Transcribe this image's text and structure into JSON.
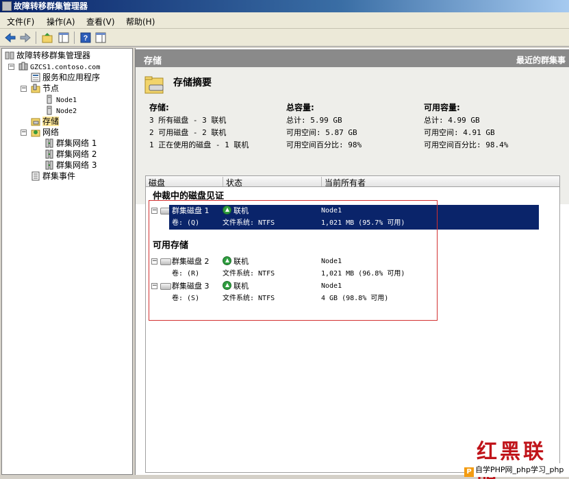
{
  "window": {
    "title": "故障转移群集管理器"
  },
  "menu": [
    "文件(F)",
    "操作(A)",
    "查看(V)",
    "帮助(H)"
  ],
  "tree": {
    "root": "故障转移群集管理器",
    "cluster": "GZCS1.contoso.com",
    "services": "服务和应用程序",
    "nodes": "节点",
    "node1": "Node1",
    "node2": "Node2",
    "storage": "存储",
    "networks": "网络",
    "net1": "群集网络 1",
    "net2": "群集网络 2",
    "net3": "群集网络 3",
    "events": "群集事件"
  },
  "main": {
    "header": "存储",
    "header_right": "最近的群集事",
    "summary_title": "存储摘要",
    "storage": {
      "heading": "存储:",
      "lines": [
        "3 所有磁盘 - 3 联机",
        "2 可用磁盘 - 2 联机",
        "1 正在使用的磁盘 - 1 联机"
      ]
    },
    "total": {
      "heading": "总容量:",
      "lines": [
        "总计: 5.99 GB",
        "可用空间: 5.87 GB",
        "可用空间百分比: 98%"
      ]
    },
    "available": {
      "heading": "可用容量:",
      "lines": [
        "总计: 4.99 GB",
        "可用空间: 4.91 GB",
        "可用空间百分比: 98.4%"
      ]
    }
  },
  "list": {
    "columns": [
      "磁盘",
      "状态",
      "当前所有者"
    ],
    "group_witness": "仲裁中的磁盘见证",
    "group_available": "可用存储",
    "disks": [
      {
        "name": "群集磁盘 1",
        "status": "联机",
        "owner": "Node1",
        "volume": "卷: (Q)",
        "fs": "文件系统: NTFS",
        "size": "1,021 MB (95.7% 可用)"
      },
      {
        "name": "群集磁盘 2",
        "status": "联机",
        "owner": "Node1",
        "volume": "卷: (R)",
        "fs": "文件系统: NTFS",
        "size": "1,021 MB (96.8% 可用)"
      },
      {
        "name": "群集磁盘 3",
        "status": "联机",
        "owner": "Node1",
        "volume": "卷: (S)",
        "fs": "文件系统: NTFS",
        "size": "4 GB (98.8% 可用)"
      }
    ]
  },
  "watermark": {
    "text": "自学PHP网_php学习_php教",
    "stamp": "红黑联盟"
  }
}
